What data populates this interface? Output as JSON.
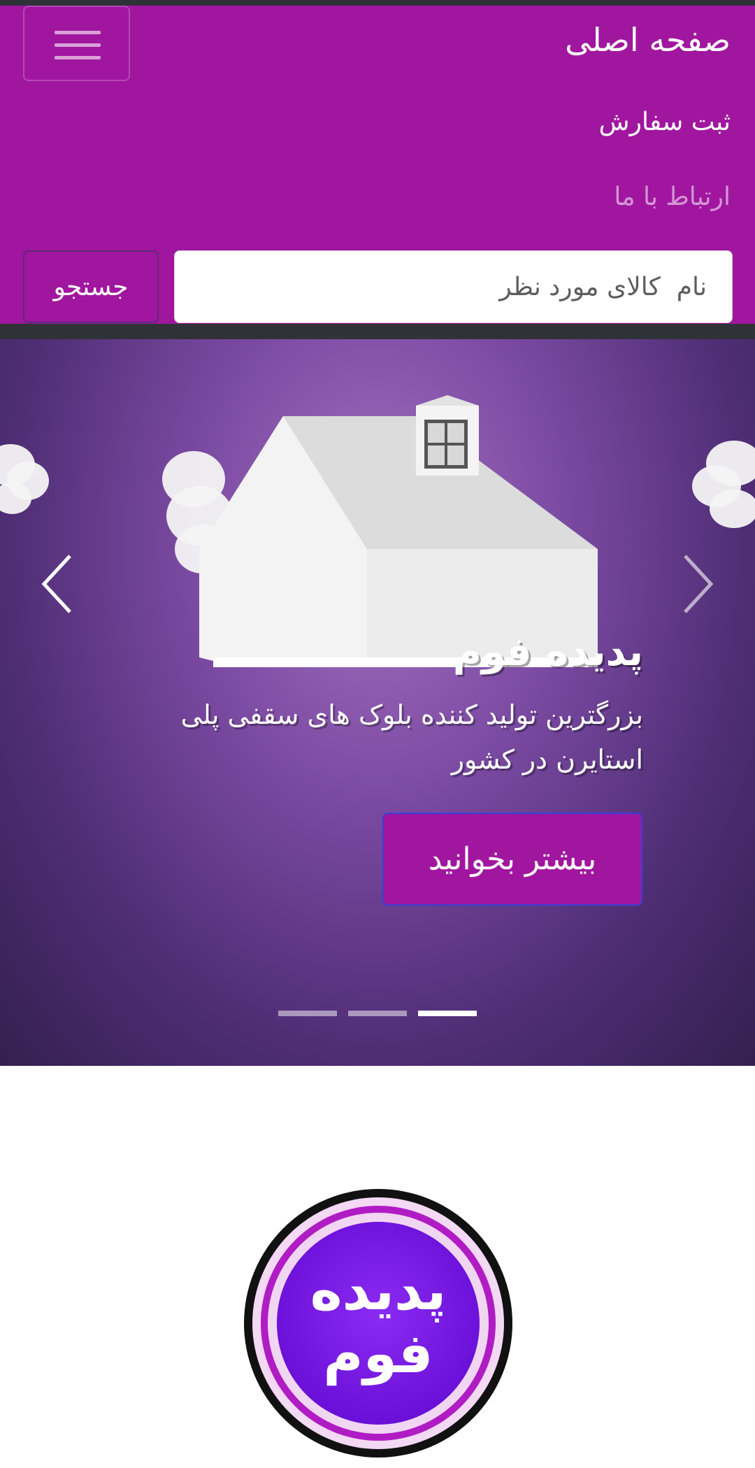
{
  "navbar": {
    "brand": "صفحه اصلی",
    "links": [
      {
        "label": "ثبت سفارش",
        "state": "default"
      },
      {
        "label": "ارتباط با ما",
        "state": "muted"
      }
    ],
    "toggle_icon": "hamburger-icon"
  },
  "search": {
    "placeholder": "نام  کالای مورد نظر",
    "button_label": "جستجو"
  },
  "carousel": {
    "title": "پدیده فوم",
    "text": "بزرگترین تولید کننده بلوک های سقفی پلی استایرن در کشور",
    "button_label": "بیشتر بخوانید",
    "slide_count": 3,
    "active_slide": 3,
    "prev_icon": "chevron-left-icon",
    "next_icon": "chevron-right-icon"
  },
  "logo": {
    "text_line1": "پدیده",
    "text_line2": "فوم"
  },
  "colors": {
    "brand_purple": "#a1169f",
    "button_border_blue": "#3b3fd6",
    "dark_strip": "#2f3237"
  }
}
